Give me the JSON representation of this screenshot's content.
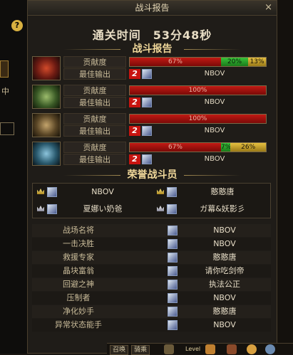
{
  "window": {
    "title": "战斗报告",
    "close_glyph": "×"
  },
  "clear_time": "通关时间　53分48秒",
  "report_heading": "战斗报告",
  "contributions": [
    {
      "label": "贡献度",
      "best_label": "最佳输出",
      "bars": [
        {
          "text": "67%",
          "pct": 67,
          "color": "red"
        },
        {
          "text": "20%",
          "pct": 20,
          "color": "green"
        },
        {
          "text": "13%",
          "pct": 13,
          "color": "gold"
        }
      ],
      "best_rank": "2",
      "best_name": "NBOV"
    },
    {
      "label": "贡献度",
      "best_label": "最佳输出",
      "bars": [
        {
          "text": "100%",
          "pct": 100,
          "color": "red"
        }
      ],
      "best_rank": "2",
      "best_name": "NBOV"
    },
    {
      "label": "贡献度",
      "best_label": "最佳输出",
      "bars": [
        {
          "text": "100%",
          "pct": 100,
          "color": "red"
        }
      ],
      "best_rank": "2",
      "best_name": "NBOV"
    },
    {
      "label": "贡献度",
      "best_label": "最佳输出",
      "bars": [
        {
          "text": "67%",
          "pct": 67,
          "color": "red"
        },
        {
          "text": "7%",
          "pct": 7,
          "color": "green"
        },
        {
          "text": "26%",
          "pct": 26,
          "color": "gold"
        }
      ],
      "best_rank": "2",
      "best_name": "NBOV"
    }
  ],
  "honor_heading": "荣誉战斗员",
  "honor": [
    {
      "name": "NBOV",
      "crown": "gold"
    },
    {
      "name": "憨憨唐",
      "crown": "gold"
    },
    {
      "name": "夏娜い奶爸",
      "crown": "silver"
    },
    {
      "name": "ガ幕&妖影彡",
      "crown": "silver"
    }
  ],
  "awards": [
    {
      "title": "战场名将",
      "winner": "NBOV"
    },
    {
      "title": "一击决胜",
      "winner": "NBOV"
    },
    {
      "title": "救援专家",
      "winner": "憨憨唐"
    },
    {
      "title": "晶块富翁",
      "winner": "请你吃剑帝"
    },
    {
      "title": "回避之神",
      "winner": "执法公正"
    },
    {
      "title": "压制者",
      "winner": "NBOV"
    },
    {
      "title": "净化妙手",
      "winner": "憨憨唐"
    },
    {
      "title": "异常状态能手",
      "winner": "NBOV"
    }
  ],
  "side": {
    "help_glyph": "?",
    "char": "中"
  },
  "bottom_tabs": [
    "召唤",
    "骑乘"
  ],
  "bottom_level_label": "Level",
  "colors": {
    "red": "#c21a14",
    "green": "#39c43a",
    "gold": "#e6c040",
    "heading": "#f0d89a"
  }
}
